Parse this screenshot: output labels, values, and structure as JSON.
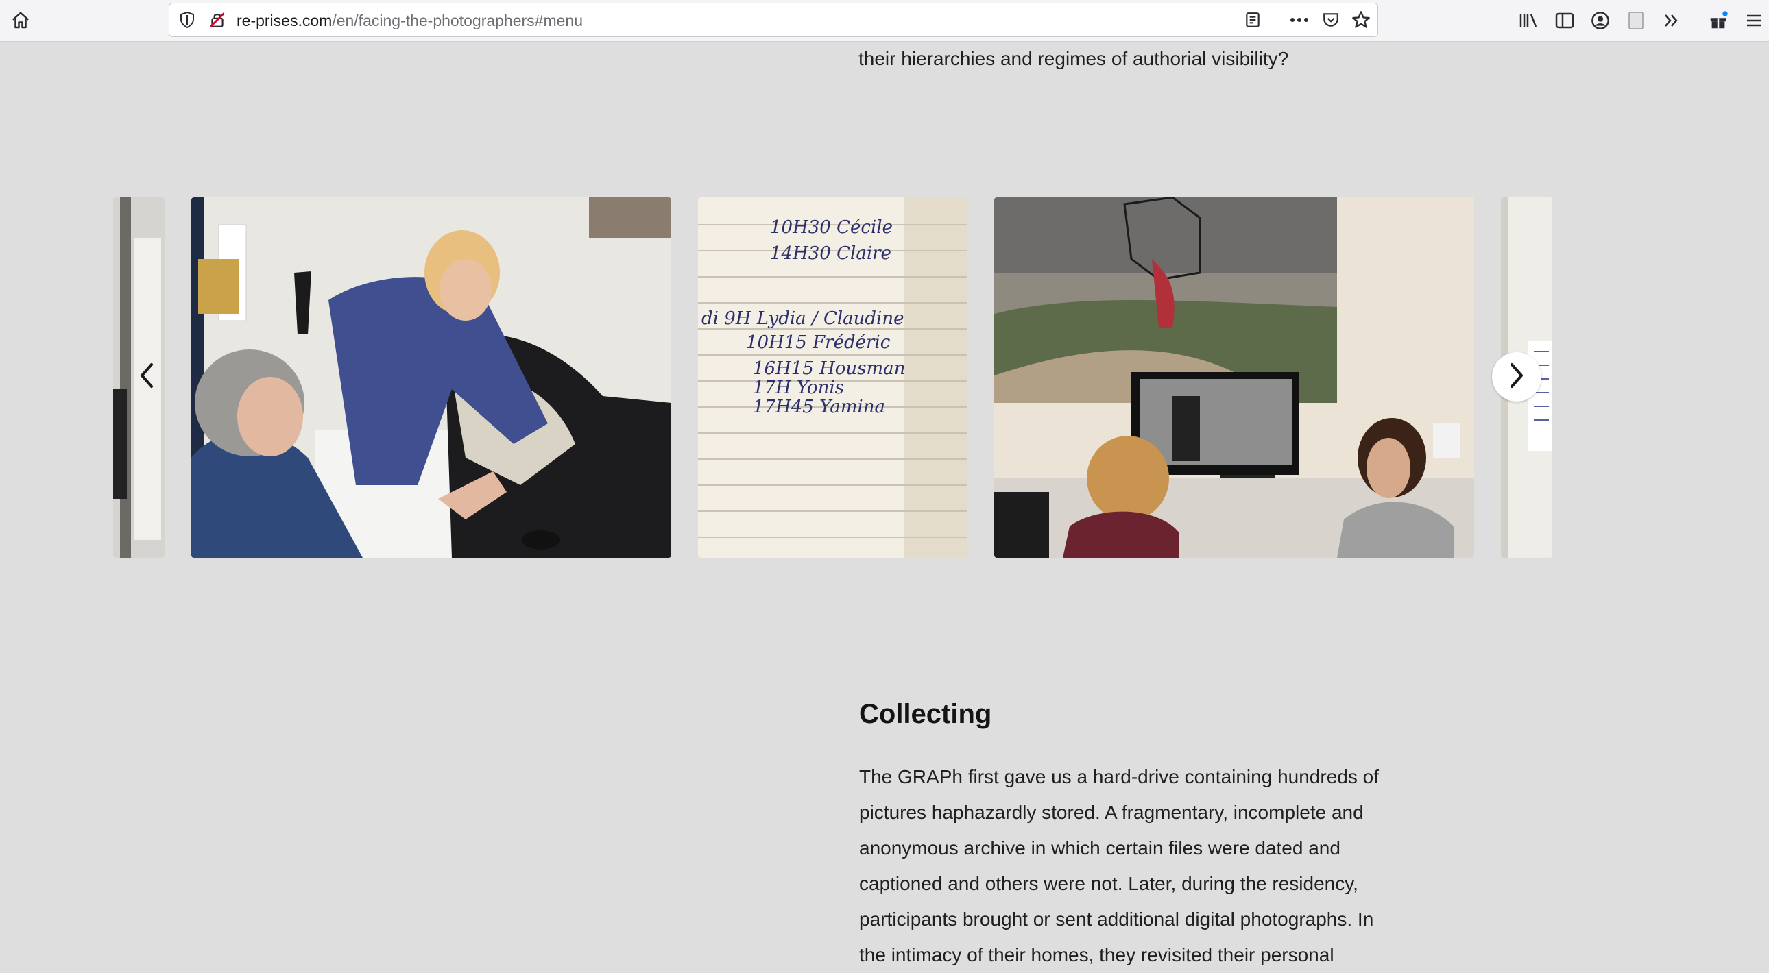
{
  "browser": {
    "url_domain": "re-prises.com",
    "url_path": "/en/facing-the-photographers#menu"
  },
  "article": {
    "intro_tail": "their hierarchies and regimes of authorial visibility?",
    "section_title": "Collecting",
    "section_lines": [
      "The GRAPh first gave us a hard-drive containing hundreds of",
      "pictures haphazardly stored. A fragmentary, incomplete and",
      "anonymous archive in which certain files were dated and",
      "captioned and others were not. Later, during the residency,",
      "participants brought or sent additional digital photographs. In",
      "the intimacy of their homes, they revisited their personal"
    ]
  },
  "carousel": {
    "notebook_lines": [
      "10H30 Cécile",
      "14H30 Claire",
      "di 9H Lydia / Claudine",
      "10H15 Frédéric",
      "16H15 Housman",
      "17H Yonis",
      "17H45 Yamina"
    ]
  },
  "colors": {
    "page_background": "#dedede",
    "toolbar_background": "#f4f4f6",
    "text": "#1f1f1f"
  }
}
